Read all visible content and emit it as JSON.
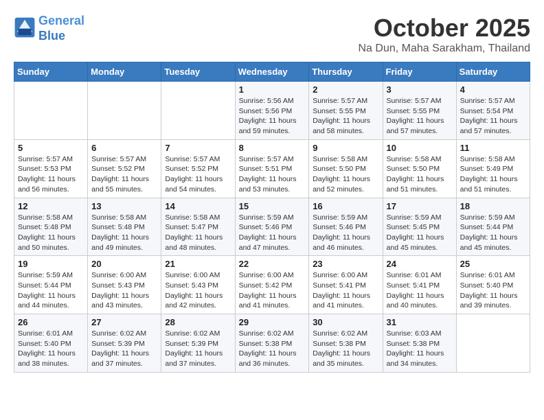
{
  "header": {
    "logo_line1": "General",
    "logo_line2": "Blue",
    "month_title": "October 2025",
    "subtitle": "Na Dun, Maha Sarakham, Thailand"
  },
  "weekdays": [
    "Sunday",
    "Monday",
    "Tuesday",
    "Wednesday",
    "Thursday",
    "Friday",
    "Saturday"
  ],
  "weeks": [
    [
      {
        "day": "",
        "sunrise": "",
        "sunset": "",
        "daylight": ""
      },
      {
        "day": "",
        "sunrise": "",
        "sunset": "",
        "daylight": ""
      },
      {
        "day": "",
        "sunrise": "",
        "sunset": "",
        "daylight": ""
      },
      {
        "day": "1",
        "sunrise": "Sunrise: 5:56 AM",
        "sunset": "Sunset: 5:56 PM",
        "daylight": "Daylight: 11 hours and 59 minutes."
      },
      {
        "day": "2",
        "sunrise": "Sunrise: 5:57 AM",
        "sunset": "Sunset: 5:55 PM",
        "daylight": "Daylight: 11 hours and 58 minutes."
      },
      {
        "day": "3",
        "sunrise": "Sunrise: 5:57 AM",
        "sunset": "Sunset: 5:55 PM",
        "daylight": "Daylight: 11 hours and 57 minutes."
      },
      {
        "day": "4",
        "sunrise": "Sunrise: 5:57 AM",
        "sunset": "Sunset: 5:54 PM",
        "daylight": "Daylight: 11 hours and 57 minutes."
      }
    ],
    [
      {
        "day": "5",
        "sunrise": "Sunrise: 5:57 AM",
        "sunset": "Sunset: 5:53 PM",
        "daylight": "Daylight: 11 hours and 56 minutes."
      },
      {
        "day": "6",
        "sunrise": "Sunrise: 5:57 AM",
        "sunset": "Sunset: 5:52 PM",
        "daylight": "Daylight: 11 hours and 55 minutes."
      },
      {
        "day": "7",
        "sunrise": "Sunrise: 5:57 AM",
        "sunset": "Sunset: 5:52 PM",
        "daylight": "Daylight: 11 hours and 54 minutes."
      },
      {
        "day": "8",
        "sunrise": "Sunrise: 5:57 AM",
        "sunset": "Sunset: 5:51 PM",
        "daylight": "Daylight: 11 hours and 53 minutes."
      },
      {
        "day": "9",
        "sunrise": "Sunrise: 5:58 AM",
        "sunset": "Sunset: 5:50 PM",
        "daylight": "Daylight: 11 hours and 52 minutes."
      },
      {
        "day": "10",
        "sunrise": "Sunrise: 5:58 AM",
        "sunset": "Sunset: 5:50 PM",
        "daylight": "Daylight: 11 hours and 51 minutes."
      },
      {
        "day": "11",
        "sunrise": "Sunrise: 5:58 AM",
        "sunset": "Sunset: 5:49 PM",
        "daylight": "Daylight: 11 hours and 51 minutes."
      }
    ],
    [
      {
        "day": "12",
        "sunrise": "Sunrise: 5:58 AM",
        "sunset": "Sunset: 5:48 PM",
        "daylight": "Daylight: 11 hours and 50 minutes."
      },
      {
        "day": "13",
        "sunrise": "Sunrise: 5:58 AM",
        "sunset": "Sunset: 5:48 PM",
        "daylight": "Daylight: 11 hours and 49 minutes."
      },
      {
        "day": "14",
        "sunrise": "Sunrise: 5:58 AM",
        "sunset": "Sunset: 5:47 PM",
        "daylight": "Daylight: 11 hours and 48 minutes."
      },
      {
        "day": "15",
        "sunrise": "Sunrise: 5:59 AM",
        "sunset": "Sunset: 5:46 PM",
        "daylight": "Daylight: 11 hours and 47 minutes."
      },
      {
        "day": "16",
        "sunrise": "Sunrise: 5:59 AM",
        "sunset": "Sunset: 5:46 PM",
        "daylight": "Daylight: 11 hours and 46 minutes."
      },
      {
        "day": "17",
        "sunrise": "Sunrise: 5:59 AM",
        "sunset": "Sunset: 5:45 PM",
        "daylight": "Daylight: 11 hours and 45 minutes."
      },
      {
        "day": "18",
        "sunrise": "Sunrise: 5:59 AM",
        "sunset": "Sunset: 5:44 PM",
        "daylight": "Daylight: 11 hours and 45 minutes."
      }
    ],
    [
      {
        "day": "19",
        "sunrise": "Sunrise: 5:59 AM",
        "sunset": "Sunset: 5:44 PM",
        "daylight": "Daylight: 11 hours and 44 minutes."
      },
      {
        "day": "20",
        "sunrise": "Sunrise: 6:00 AM",
        "sunset": "Sunset: 5:43 PM",
        "daylight": "Daylight: 11 hours and 43 minutes."
      },
      {
        "day": "21",
        "sunrise": "Sunrise: 6:00 AM",
        "sunset": "Sunset: 5:43 PM",
        "daylight": "Daylight: 11 hours and 42 minutes."
      },
      {
        "day": "22",
        "sunrise": "Sunrise: 6:00 AM",
        "sunset": "Sunset: 5:42 PM",
        "daylight": "Daylight: 11 hours and 41 minutes."
      },
      {
        "day": "23",
        "sunrise": "Sunrise: 6:00 AM",
        "sunset": "Sunset: 5:41 PM",
        "daylight": "Daylight: 11 hours and 41 minutes."
      },
      {
        "day": "24",
        "sunrise": "Sunrise: 6:01 AM",
        "sunset": "Sunset: 5:41 PM",
        "daylight": "Daylight: 11 hours and 40 minutes."
      },
      {
        "day": "25",
        "sunrise": "Sunrise: 6:01 AM",
        "sunset": "Sunset: 5:40 PM",
        "daylight": "Daylight: 11 hours and 39 minutes."
      }
    ],
    [
      {
        "day": "26",
        "sunrise": "Sunrise: 6:01 AM",
        "sunset": "Sunset: 5:40 PM",
        "daylight": "Daylight: 11 hours and 38 minutes."
      },
      {
        "day": "27",
        "sunrise": "Sunrise: 6:02 AM",
        "sunset": "Sunset: 5:39 PM",
        "daylight": "Daylight: 11 hours and 37 minutes."
      },
      {
        "day": "28",
        "sunrise": "Sunrise: 6:02 AM",
        "sunset": "Sunset: 5:39 PM",
        "daylight": "Daylight: 11 hours and 37 minutes."
      },
      {
        "day": "29",
        "sunrise": "Sunrise: 6:02 AM",
        "sunset": "Sunset: 5:38 PM",
        "daylight": "Daylight: 11 hours and 36 minutes."
      },
      {
        "day": "30",
        "sunrise": "Sunrise: 6:02 AM",
        "sunset": "Sunset: 5:38 PM",
        "daylight": "Daylight: 11 hours and 35 minutes."
      },
      {
        "day": "31",
        "sunrise": "Sunrise: 6:03 AM",
        "sunset": "Sunset: 5:38 PM",
        "daylight": "Daylight: 11 hours and 34 minutes."
      },
      {
        "day": "",
        "sunrise": "",
        "sunset": "",
        "daylight": ""
      }
    ]
  ]
}
